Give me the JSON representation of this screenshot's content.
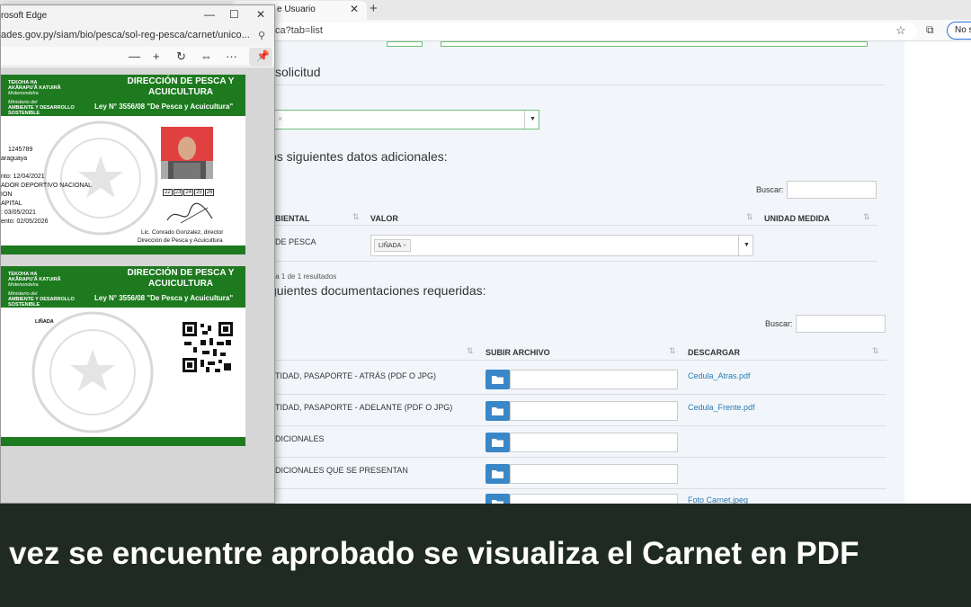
{
  "bg_browser": {
    "tab_title": "e Usuario",
    "url": "ca?tab=list",
    "nosync_label": "No s"
  },
  "page": {
    "section_title": "solicitud",
    "additional_heading": "os siguientes datos adicionales:",
    "search1_label": "Buscar:",
    "table1_headers": [
      "BIENTAL",
      "VALOR",
      "UNIDAD MEDIDA"
    ],
    "table1_row_label": "DE PESCA",
    "table1_row_value": "LIÑADA",
    "table1_info": "sta 1 de 1 resultados",
    "docs_heading": "guientes documentaciones requeridas:",
    "search2_label": "Buscar:",
    "table2_headers": [
      "SUBIR ARCHIVO",
      "DESCARGAR"
    ],
    "table2_rows": [
      {
        "label": "TIDAD, PASAPORTE - ATRÁS (PDF O JPG)",
        "download": "Cedula_Atras.pdf"
      },
      {
        "label": "TIDAD, PASAPORTE - ADELANTE (PDF O JPG)",
        "download": "Cedula_Frente.pdf"
      },
      {
        "label": "DICIONALES",
        "download": ""
      },
      {
        "label": "DICIONALES QUE SE PRESENTAN",
        "download": ""
      },
      {
        "label": "",
        "download": "Foto Carnet.jpeg"
      }
    ]
  },
  "pdf_window": {
    "title": "rosoft Edge",
    "url": "ades.gov.py/siam/bio/pesca/sol-reg-pesca/carnet/unico...",
    "card_front": {
      "header_small_1": "TEKOHA HA",
      "header_small_2": "AKÃRAPU'Ã KATUIRÃ",
      "header_small_3": "Motenondeha",
      "header_small_4": "Ministerio del",
      "header_small_5": "AMBIENTE Y DESARROLLO",
      "header_small_6": "SOSTENIBLE",
      "title": "DIRECCIÓN DE PESCA Y ACUICULTURA",
      "law": "Ley N° 3556/08 \"De Pesca y Acuicultura\"",
      "field_id": "1245789",
      "field_nat": "araguaya",
      "field_birth": "nto: 12/04/2021",
      "field_org1": "ADOR DEPORTIVO NACIONAL",
      "field_org2": "ION",
      "field_city": "APITAL",
      "field_issue": ":        03/05/2021",
      "field_expiry": "ento:      02/05/2026",
      "photo_numbers": [
        "22",
        "23",
        "24",
        "25",
        "26"
      ],
      "signer": "Lic. Conrado Gonzalez, director",
      "signer_dept": "Dirección de Pesca y Acuicultura",
      "seal_text": "REPUBLICA DEL PARAGUAY"
    },
    "card_back": {
      "header_small_1": "TEKOHA HA",
      "header_small_2": "AKÃRAPU'Ã KATUIRÃ",
      "header_small_3": "Motenondeha",
      "header_small_4": "Ministerio del",
      "header_small_5": "AMBIENTE Y DESARROLLO",
      "header_small_6": "SOSTENIBLE",
      "title": "DIRECCIÓN DE PESCA Y ACUICULTURA",
      "law": "Ley N° 3556/08 \"De Pesca y Acuicultura\"",
      "arte": "LIÑADA",
      "seal_text": "REPUBLICA DEL PARAGUAY"
    }
  },
  "caption": "vez se encuentre aprobado se visualiza el Carnet en PDF",
  "colors": {
    "card_green": "#1d7a1f",
    "link_blue": "#2a7ab0",
    "button_blue": "#3a87c8",
    "caption_bg": "#1f2b22"
  }
}
